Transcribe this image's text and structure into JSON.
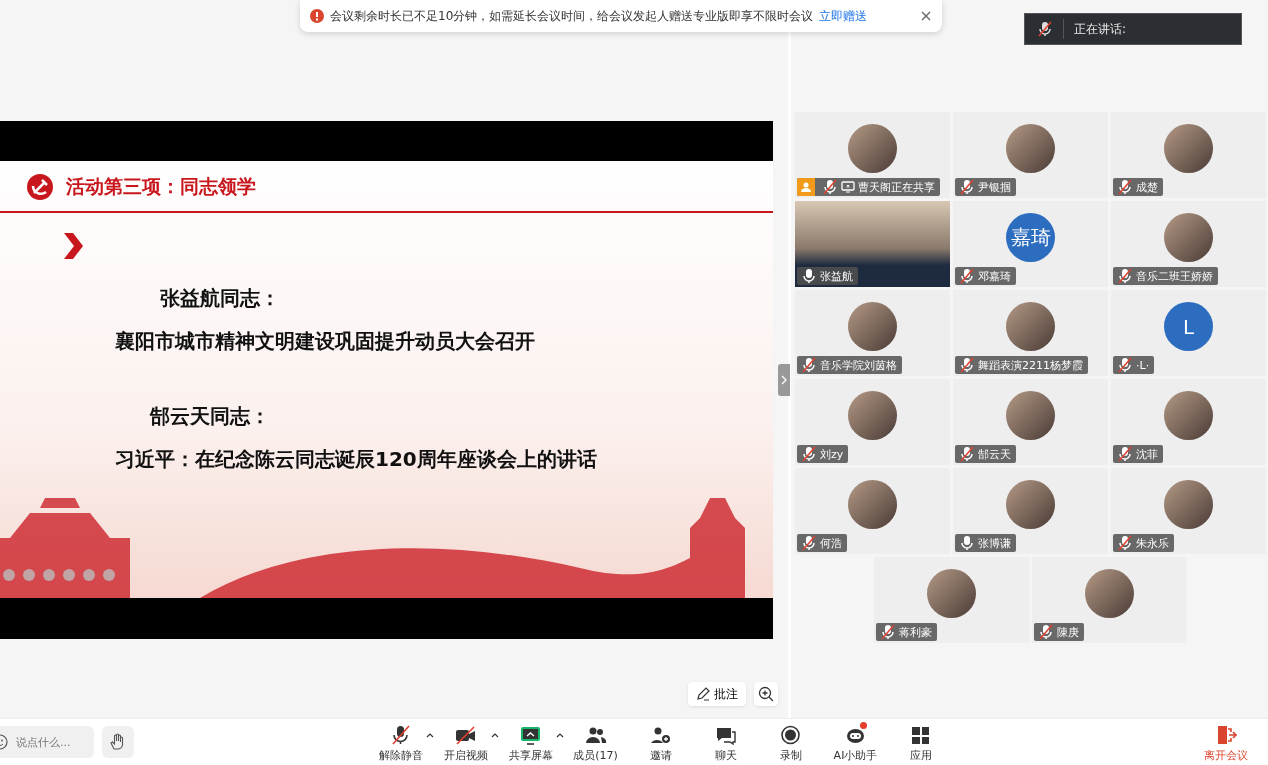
{
  "notice": {
    "text": "会议剩余时长已不足10分钟，如需延长会议时间，给会议发起人赠送专业版即享不限时会议",
    "link": "立即赠送"
  },
  "speaking": {
    "label": "正在讲话:",
    "muted": true
  },
  "slide": {
    "title": "活动第三项：同志领学",
    "blocks": [
      {
        "kind": "name",
        "text": "张益航同志："
      },
      {
        "kind": "topic",
        "text": "襄阳市城市精神文明建设巩固提升动员大会召开"
      },
      {
        "kind": "name",
        "text": "郜云天同志："
      },
      {
        "kind": "topic",
        "text": "习近平：在纪念陈云同志诞辰120周年座谈会上的讲话"
      }
    ]
  },
  "stage_tools": {
    "annotate": "批注"
  },
  "participants": [
    {
      "name": "曹天阁正在共享",
      "kind": "photo",
      "muted": true,
      "host": true,
      "sharing": true
    },
    {
      "name": "尹银掴",
      "kind": "photo",
      "muted": true,
      "host": false,
      "sharing": false
    },
    {
      "name": "成楚",
      "kind": "photo",
      "muted": true,
      "host": false,
      "sharing": false
    },
    {
      "name": "张益航",
      "kind": "video",
      "muted": false,
      "host": false,
      "sharing": false
    },
    {
      "name": "邓嘉琦",
      "kind": "initials",
      "initials": "嘉琦",
      "muted": true,
      "host": false,
      "sharing": false
    },
    {
      "name": "音乐二班王娇娇",
      "kind": "photo",
      "muted": true,
      "host": false,
      "sharing": false
    },
    {
      "name": "音乐学院刘茵格",
      "kind": "photo",
      "muted": true,
      "host": false,
      "sharing": false
    },
    {
      "name": "舞蹈表演2211杨梦霞",
      "kind": "photo",
      "muted": true,
      "host": false,
      "sharing": false
    },
    {
      "name": "·L·",
      "kind": "initials",
      "initials": "L",
      "muted": true,
      "host": false,
      "sharing": false
    },
    {
      "name": "刘zy",
      "kind": "photo",
      "muted": true,
      "host": false,
      "sharing": false
    },
    {
      "name": "郜云天",
      "kind": "photo",
      "muted": true,
      "host": false,
      "sharing": false
    },
    {
      "name": "沈菲",
      "kind": "photo",
      "muted": true,
      "host": false,
      "sharing": false
    },
    {
      "name": "何浩",
      "kind": "photo",
      "muted": true,
      "host": false,
      "sharing": false
    },
    {
      "name": "张博谦",
      "kind": "photo",
      "muted": false,
      "host": false,
      "sharing": false
    },
    {
      "name": "朱永乐",
      "kind": "photo",
      "muted": true,
      "host": false,
      "sharing": false
    },
    {
      "name": "蒋利豪",
      "kind": "photo",
      "muted": true,
      "host": false,
      "sharing": false
    },
    {
      "name": "陳庚",
      "kind": "photo",
      "muted": true,
      "host": false,
      "sharing": false
    }
  ],
  "chat": {
    "placeholder": "说点什么..."
  },
  "toolbar": [
    {
      "kind": "mic",
      "label": "解除静音",
      "menu": true,
      "badge": false
    },
    {
      "kind": "video",
      "label": "开启视频",
      "menu": true,
      "badge": false
    },
    {
      "kind": "share",
      "label": "共享屏幕",
      "menu": true,
      "badge": false
    },
    {
      "kind": "members",
      "label": "成员(17)",
      "menu": false,
      "badge": false
    },
    {
      "kind": "invite",
      "label": "邀请",
      "menu": false,
      "badge": false
    },
    {
      "kind": "chat",
      "label": "聊天",
      "menu": false,
      "badge": false
    },
    {
      "kind": "record",
      "label": "录制",
      "menu": false,
      "badge": false
    },
    {
      "kind": "ai",
      "label": "AI小助手",
      "menu": false,
      "badge": true
    },
    {
      "kind": "apps",
      "label": "应用",
      "menu": false,
      "badge": false
    }
  ],
  "leave": {
    "label": "离开会议"
  }
}
